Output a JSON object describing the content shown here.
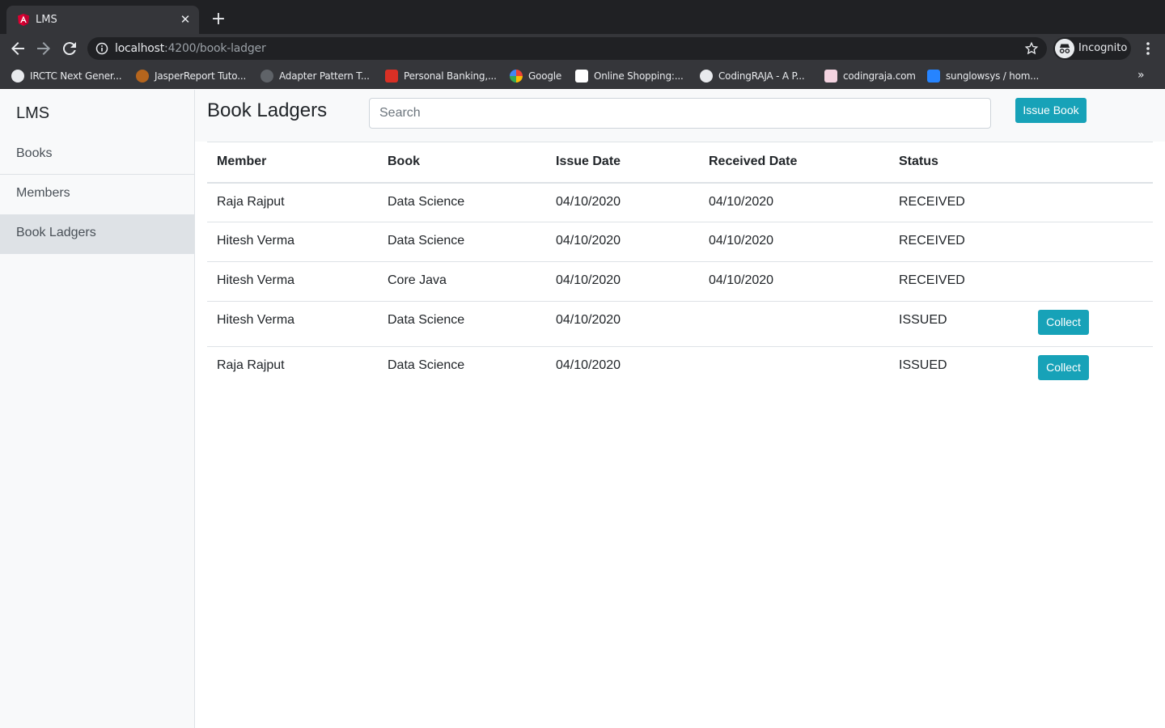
{
  "browser": {
    "tab_title": "LMS",
    "url_host": "localhost",
    "url_path": ":4200/book-ladger",
    "profile_label": "Incognito",
    "bookmarks": [
      {
        "label": "IRCTC Next Gener...",
        "icon": "globe-icon",
        "color": "#e8eaed"
      },
      {
        "label": "JasperReport Tuto...",
        "icon": "jasper-icon",
        "color": "#b5651d"
      },
      {
        "label": "Adapter Pattern T...",
        "icon": "hex-icon",
        "color": "#5f6368"
      },
      {
        "label": "Personal Banking,...",
        "icon": "bank-icon",
        "color": "#d93025"
      },
      {
        "label": "Google",
        "icon": "google-icon",
        "color": "#4285f4"
      },
      {
        "label": "Online Shopping:...",
        "icon": "amazon-icon",
        "color": "#ffffff"
      },
      {
        "label": "CodingRAJA - A P...",
        "icon": "globe-icon",
        "color": "#e8eaed"
      },
      {
        "label": "codingraja.com",
        "icon": "codingraja-icon",
        "color": "#f3d3e0"
      },
      {
        "label": "sunglowsys / hom...",
        "icon": "bitbucket-icon",
        "color": "#2684ff"
      }
    ],
    "more_label": "»"
  },
  "sidebar": {
    "brand": "LMS",
    "items": [
      {
        "label": "Books"
      },
      {
        "label": "Members"
      },
      {
        "label": "Book Ladgers"
      }
    ]
  },
  "header": {
    "title": "Book Ladgers",
    "search_placeholder": "Search",
    "issue_button": "Issue Book"
  },
  "table": {
    "columns": [
      "Member",
      "Book",
      "Issue Date",
      "Received Date",
      "Status"
    ],
    "rows": [
      {
        "member": "Raja Rajput",
        "book": "Data Science",
        "issue_date": "04/10/2020",
        "received_date": "04/10/2020",
        "status": "RECEIVED",
        "action": ""
      },
      {
        "member": "Hitesh Verma",
        "book": "Data Science",
        "issue_date": "04/10/2020",
        "received_date": "04/10/2020",
        "status": "RECEIVED",
        "action": ""
      },
      {
        "member": "Hitesh Verma",
        "book": "Core Java",
        "issue_date": "04/10/2020",
        "received_date": "04/10/2020",
        "status": "RECEIVED",
        "action": ""
      },
      {
        "member": "Hitesh Verma",
        "book": "Data Science",
        "issue_date": "04/10/2020",
        "received_date": "",
        "status": "ISSUED",
        "action": "Collect"
      },
      {
        "member": "Raja Rajput",
        "book": "Data Science",
        "issue_date": "04/10/2020",
        "received_date": "",
        "status": "ISSUED",
        "action": "Collect"
      }
    ]
  },
  "colors": {
    "accent": "#17a2b8",
    "sidebar_bg": "#f8f9fa",
    "active_item_bg": "#dee2e6"
  }
}
